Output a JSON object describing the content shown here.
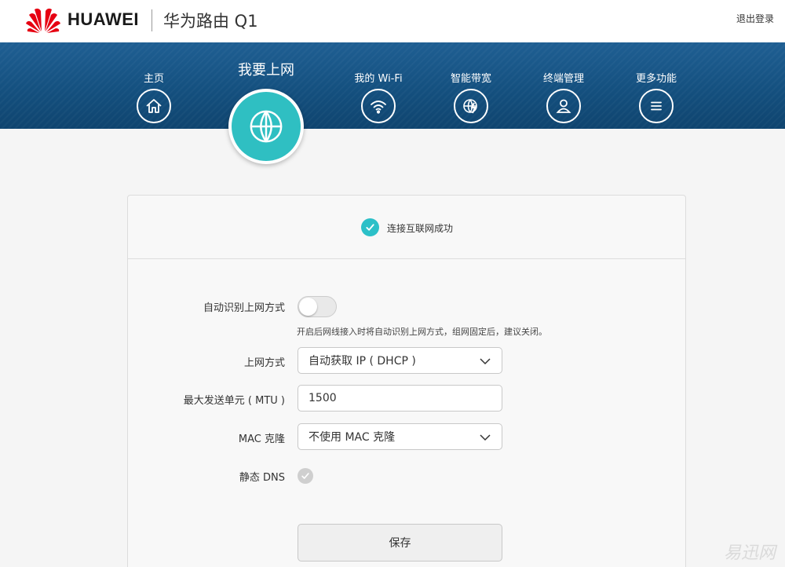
{
  "header": {
    "brand": "HUAWEI",
    "product": "华为路由 Q1",
    "logout": "退出登录",
    "brand_color": "#e60012"
  },
  "nav": {
    "items": [
      {
        "label": "主页",
        "icon": "home-icon"
      },
      {
        "label": "我要上网",
        "icon": "globe-icon",
        "active": true
      },
      {
        "label": "我的 Wi-Fi",
        "icon": "wifi-icon"
      },
      {
        "label": "智能带宽",
        "icon": "bandwidth-icon"
      },
      {
        "label": "终端管理",
        "icon": "user-icon"
      },
      {
        "label": "更多功能",
        "icon": "menu-icon"
      }
    ],
    "active_color": "#2fbfc2"
  },
  "status": {
    "text": "连接互联网成功",
    "color": "#2cc0c8"
  },
  "form": {
    "auto_detect": {
      "label": "自动识别上网方式",
      "enabled": false,
      "hint": "开启后网线接入时将自动识别上网方式，组网固定后，建议关闭。"
    },
    "connection_type": {
      "label": "上网方式",
      "value": "自动获取 IP ( DHCP )"
    },
    "mtu": {
      "label": "最大发送单元 ( MTU )",
      "value": "1500"
    },
    "mac_clone": {
      "label": "MAC 克隆",
      "value": "不使用 MAC 克隆"
    },
    "static_dns": {
      "label": "静态 DNS",
      "checked": false
    },
    "save_label": "保存"
  },
  "watermark": "易迅网"
}
